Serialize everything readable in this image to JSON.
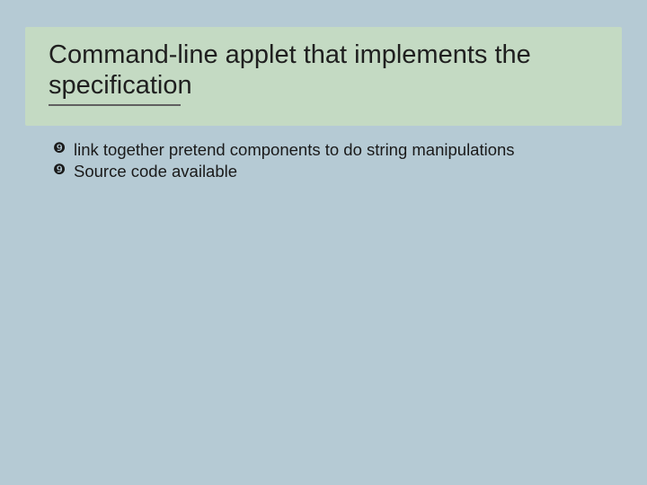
{
  "title": "Command-line applet that implements the specification",
  "bullets": [
    "link together pretend components to do string manipulations",
    "Source code available"
  ]
}
